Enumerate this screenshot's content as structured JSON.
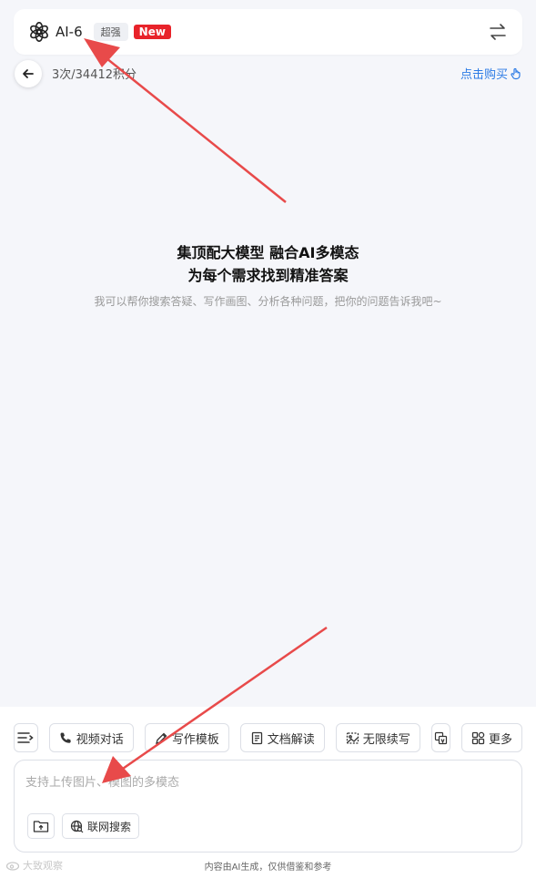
{
  "header": {
    "model_name": "AI-6",
    "badge_strong": "超强",
    "badge_new": "New",
    "icons": {
      "logo": "openai-logo-icon",
      "switch": "swap-arrows-icon"
    }
  },
  "usage": {
    "text": "3次/34412积分",
    "buy_label": "点击购买"
  },
  "hero": {
    "line1": "集顶配大模型 融合AI多模态",
    "line2": "为每个需求找到精准答案",
    "subtitle": "我可以帮你搜索答疑、写作画图、分析各种问题，把你的问题告诉我吧~"
  },
  "toolbar": {
    "items": [
      {
        "label": "视频对话",
        "icon": "phone-icon"
      },
      {
        "label": "写作模板",
        "icon": "pen-icon"
      },
      {
        "label": "文档解读",
        "icon": "document-icon"
      },
      {
        "label": "无限续写",
        "icon": "image-frame-icon"
      },
      {
        "label": "",
        "icon": "translate-icon"
      },
      {
        "label": "更多",
        "icon": "grid-icon"
      }
    ]
  },
  "input": {
    "placeholder": "支持上传图片、模图的多模态",
    "value": ""
  },
  "actions": {
    "web_search_label": "联网搜索"
  },
  "footer": {
    "note": "内容由AI生成，仅供借鉴和参考",
    "watermark": "大致观察"
  },
  "colors": {
    "accent_blue": "#2c7be5",
    "new_red": "#e8232a",
    "arrow_red": "#e84a4a",
    "page_bg": "#f5f6fa"
  }
}
